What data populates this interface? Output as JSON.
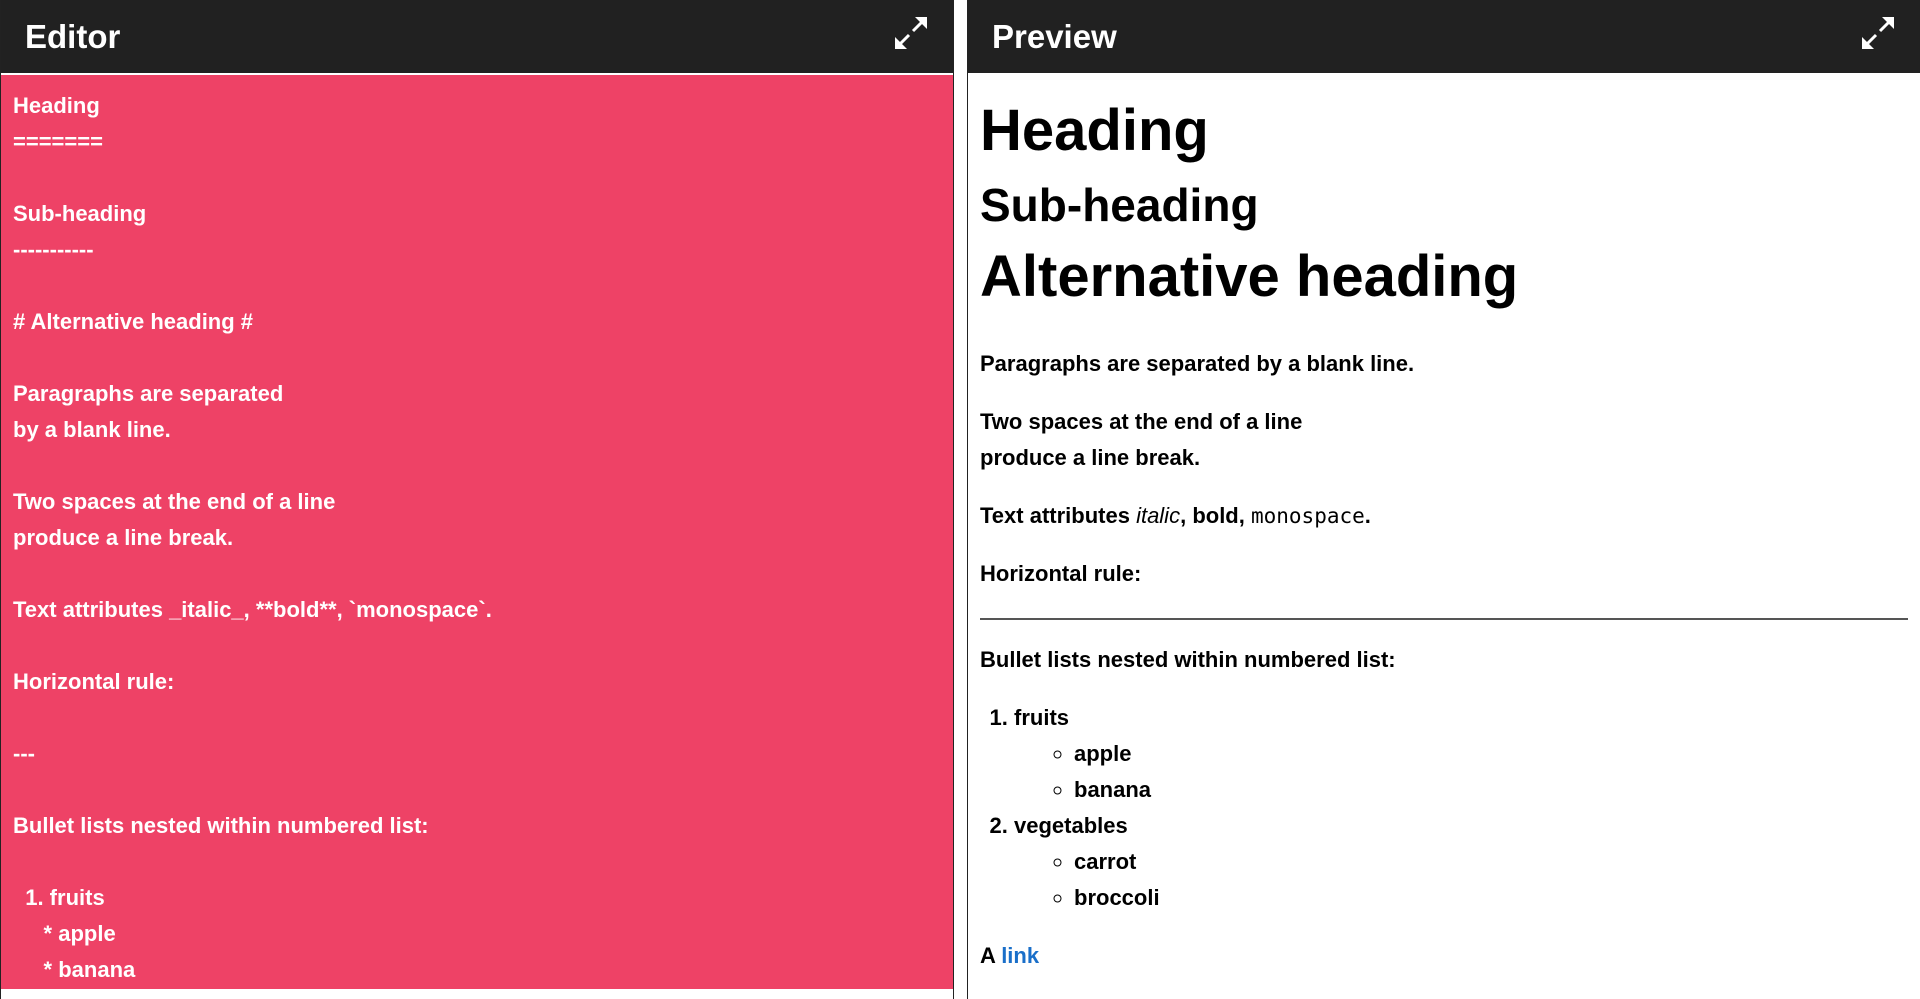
{
  "editor": {
    "title": "Editor",
    "background_color": "#ee4266",
    "text": "Heading\n=======\n\nSub-heading\n-----------\n\n# Alternative heading #\n\nParagraphs are separated\nby a blank line.\n\nTwo spaces at the end of a line\nproduce a line break.\n\nText attributes _italic_, **bold**, `monospace`.\n\nHorizontal rule:\n\n---\n\nBullet lists nested within numbered list:\n\n  1. fruits\n     * apple\n     * banana"
  },
  "preview": {
    "title": "Preview",
    "heading": "Heading",
    "subheading": "Sub-heading",
    "alt_heading": "Alternative heading",
    "para1": "Paragraphs are separated by a blank line.",
    "para2_line1": "Two spaces at the end of a line",
    "para2_line2": "produce a line break.",
    "attr_prefix": "Text attributes ",
    "attr_italic": "italic",
    "attr_sep1": ", ",
    "attr_bold": "bold",
    "attr_sep2": ", ",
    "attr_mono": "monospace",
    "attr_end": ".",
    "hr_label": "Horizontal rule:",
    "list_intro": "Bullet lists nested within numbered list:",
    "list": [
      {
        "label": "fruits",
        "items": [
          "apple",
          "banana"
        ]
      },
      {
        "label": "vegetables",
        "items": [
          "carrot",
          "broccoli"
        ]
      }
    ],
    "link_prefix": "A ",
    "link_text": "link"
  },
  "icons": {
    "expand": "expand-icon"
  },
  "colors": {
    "titlebar": "#212121",
    "link": "#1a6fc9"
  }
}
